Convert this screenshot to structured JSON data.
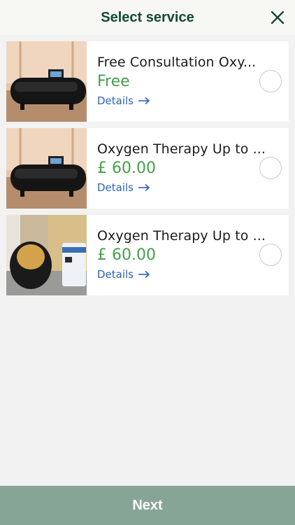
{
  "header": {
    "title": "Select service"
  },
  "services": [
    {
      "name": "Free Consultation Oxy...",
      "price": "Free",
      "details": "Details"
    },
    {
      "name": "Oxygen Therapy Up to ...",
      "price": "£ 60.00",
      "details": "Details"
    },
    {
      "name": "Oxygen Therapy Up to ...",
      "price": "£ 60.00",
      "details": "Details"
    }
  ],
  "footer": {
    "next_label": "Next"
  },
  "colors": {
    "title": "#134a34",
    "price": "#45a04a",
    "link": "#2f63b5",
    "footer_bg": "#87a596"
  },
  "icons": {
    "close": "close-icon",
    "details_arrow": "arrow-right-icon"
  }
}
